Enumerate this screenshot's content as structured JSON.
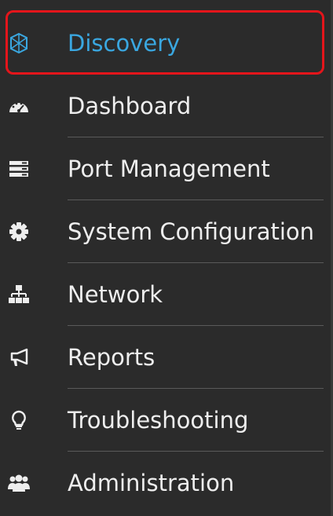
{
  "sidebar": {
    "items": [
      {
        "label": "Discovery",
        "icon": "discovery-icon",
        "active": true
      },
      {
        "label": "Dashboard",
        "icon": "dashboard-gauge-icon",
        "active": false
      },
      {
        "label": "Port Management",
        "icon": "port-list-icon",
        "active": false
      },
      {
        "label": "System Configuration",
        "icon": "gear-icon",
        "active": false
      },
      {
        "label": "Network",
        "icon": "network-tree-icon",
        "active": false
      },
      {
        "label": "Reports",
        "icon": "megaphone-icon",
        "active": false
      },
      {
        "label": "Troubleshooting",
        "icon": "lightbulb-icon",
        "active": false
      },
      {
        "label": "Administration",
        "icon": "users-icon",
        "active": false
      }
    ]
  },
  "colors": {
    "background": "#2b2b2b",
    "active_text": "#3aa7e0",
    "text": "#eeeeee",
    "highlight_border": "#e4151b"
  }
}
